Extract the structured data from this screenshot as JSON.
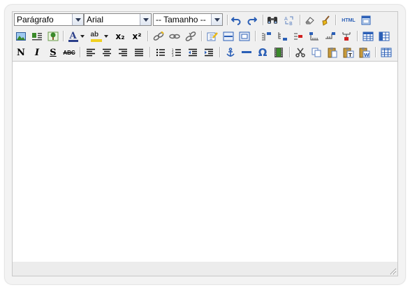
{
  "toolbar": {
    "format_select": {
      "value": "Parágrafo"
    },
    "font_select": {
      "value": "Arial"
    },
    "size_select": {
      "value": "-- Tamanho --"
    },
    "html_label": "HTML",
    "special_char": "Ω",
    "bold_glyph": "N",
    "italic_glyph": "I",
    "underline_glyph": "S",
    "strike_glyph": "ABC",
    "font_color_glyph": "A",
    "highlight_glyph": "ab",
    "subscript_glyph": "x₂",
    "superscript_glyph": "x²"
  },
  "colors": {
    "icon_blue": "#2b5fb6",
    "icon_yellow": "#e8b818",
    "icon_red": "#d02020",
    "icon_green": "#3a8a2a"
  },
  "editor": {
    "content": ""
  }
}
